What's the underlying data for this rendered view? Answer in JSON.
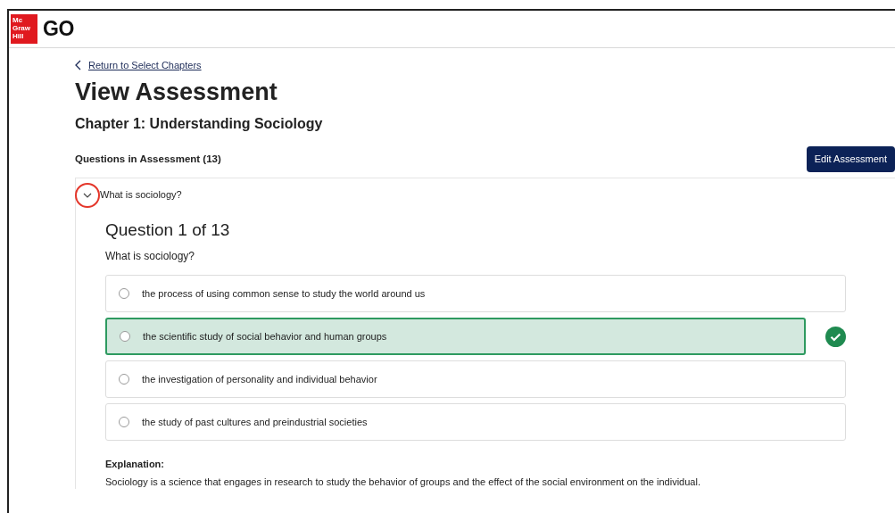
{
  "header": {
    "logo_text": "Mc Graw Hill",
    "brand": "GO"
  },
  "back_link": "Return to Select Chapters",
  "title": "View Assessment",
  "chapter": "Chapter 1: Understanding Sociology",
  "questions_heading": "Questions in Assessment (13)",
  "edit_button": "Edit Assessment",
  "question": {
    "summary": "What is sociology?",
    "expanded": true,
    "highlighted": true,
    "counter": "Question 1 of 13",
    "prompt": "What is sociology?",
    "options": [
      {
        "text": "the process of using common sense to study the world around us",
        "selected": false,
        "correct": false
      },
      {
        "text": "the scientific study of social behavior and human groups",
        "selected": false,
        "correct": true
      },
      {
        "text": "the investigation of personality and individual behavior",
        "selected": false,
        "correct": false
      },
      {
        "text": "the study of past cultures and preindustrial societies",
        "selected": false,
        "correct": false
      }
    ],
    "explanation_label": "Explanation:",
    "explanation": "Sociology is a science that engages in research to study the behavior of groups and the effect of the social environment on the individual."
  }
}
